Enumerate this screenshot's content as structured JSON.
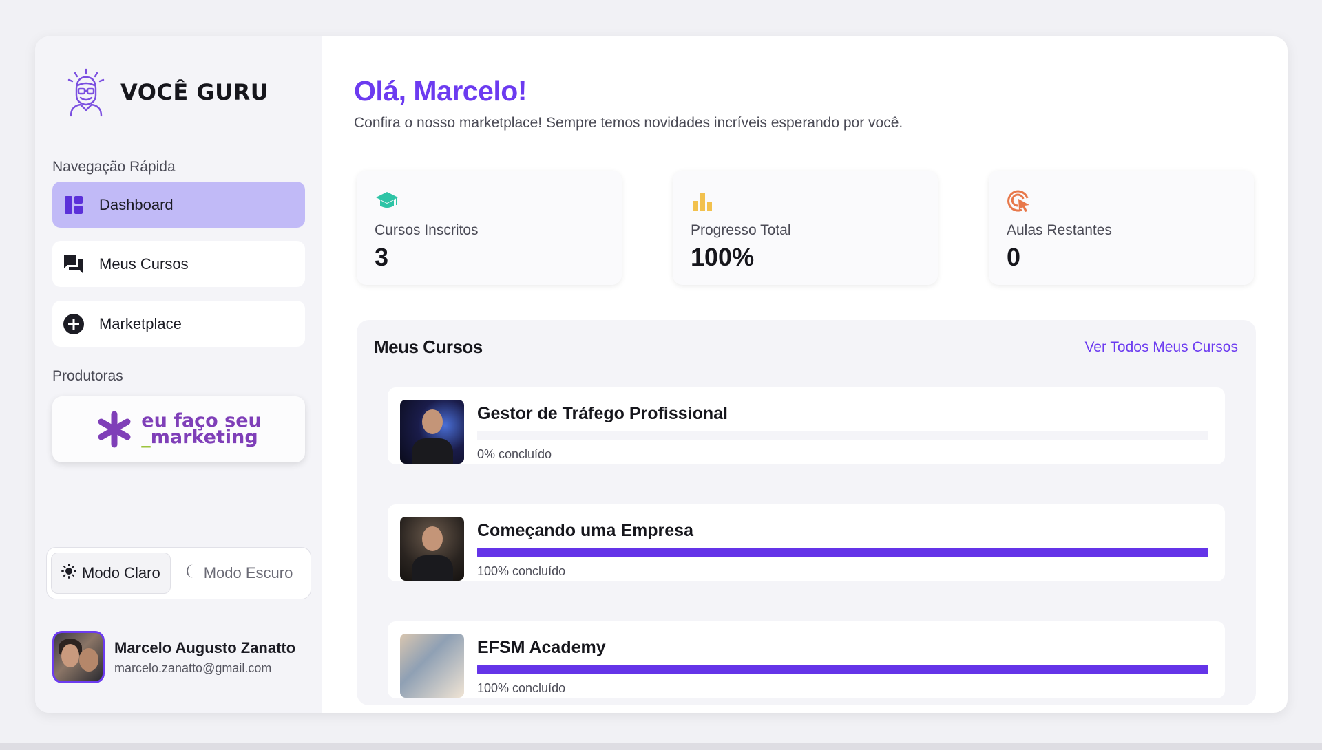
{
  "brand": {
    "name": "VOCÊ GURU"
  },
  "sidebar": {
    "quick_nav_label": "Navegação Rápida",
    "items": [
      {
        "label": "Dashboard",
        "icon": "dashboard-icon",
        "active": true
      },
      {
        "label": "Meus Cursos",
        "icon": "chat-icon",
        "active": false
      },
      {
        "label": "Marketplace",
        "icon": "plus-circle-icon",
        "active": false
      }
    ],
    "producers_label": "Produtoras",
    "producer": {
      "line1": "eu faço seu",
      "dash": "_",
      "line2": "marketing"
    }
  },
  "theme": {
    "light_label": "Modo Claro",
    "dark_label": "Modo Escuro",
    "selected": "light"
  },
  "user": {
    "name": "Marcelo Augusto Zanatto",
    "email": "marcelo.zanatto@gmail.com"
  },
  "main": {
    "greeting": "Olá, Marcelo!",
    "subtitle": "Confira o nosso marketplace! Sempre temos novidades incríveis esperando por você.",
    "stats": [
      {
        "label": "Cursos Inscritos",
        "value": "3",
        "icon": "graduation-cap-icon",
        "color": "#2ec4a6"
      },
      {
        "label": "Progresso Total",
        "value": "100%",
        "icon": "bar-chart-icon",
        "color": "#f2c14e"
      },
      {
        "label": "Aulas Restantes",
        "value": "0",
        "icon": "target-icon",
        "color": "#e8784a"
      }
    ],
    "courses_panel": {
      "title": "Meus Cursos",
      "view_all": "Ver Todos Meus Cursos",
      "courses": [
        {
          "title": "Gestor de Tráfego Profissional",
          "progress": 0,
          "status": "0% concluído"
        },
        {
          "title": "Começando uma Empresa",
          "progress": 100,
          "status": "100% concluído"
        },
        {
          "title": "EFSM Academy",
          "progress": 100,
          "status": "100% concluído"
        }
      ]
    }
  },
  "colors": {
    "accent": "#6c3bf0",
    "active_nav": "#c1baf7",
    "progress": "#6434e8"
  }
}
